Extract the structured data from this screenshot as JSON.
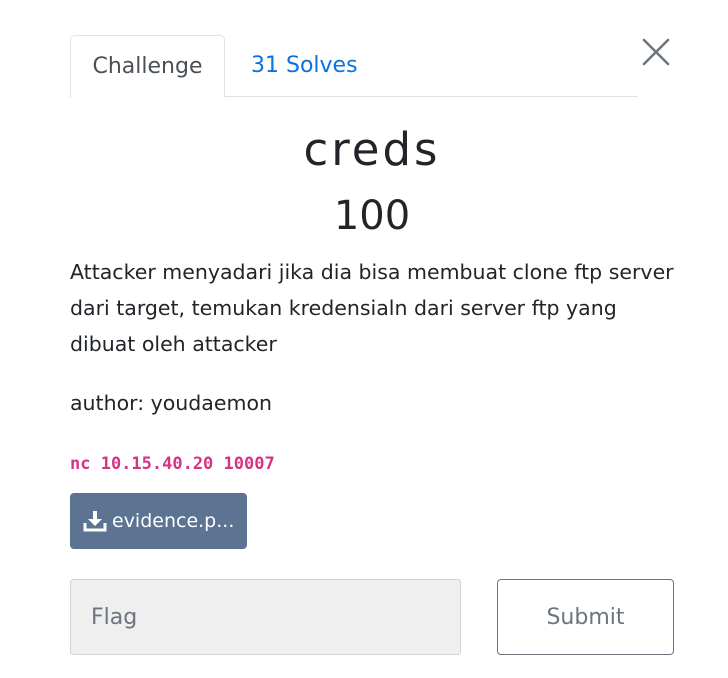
{
  "tabs": {
    "challenge_label": "Challenge",
    "solves_label": "31 Solves"
  },
  "challenge": {
    "name": "creds",
    "value": "100",
    "description": "Attacker menyadari jika dia bisa membuat clone ftp server dari target, temukan kredensialn dari server ftp yang dibuat oleh attacker",
    "author": "author: youdaemon",
    "connection": "nc 10.15.40.20 10007"
  },
  "files": {
    "file_label": "evidence.p..."
  },
  "form": {
    "flag_placeholder": "Flag",
    "submit_label": "Submit"
  },
  "colors": {
    "accent_link": "#0b72e0",
    "file_button": "#5c7391",
    "code_text": "#d63384"
  },
  "icons": {
    "close": "close-icon",
    "download": "download-icon"
  }
}
